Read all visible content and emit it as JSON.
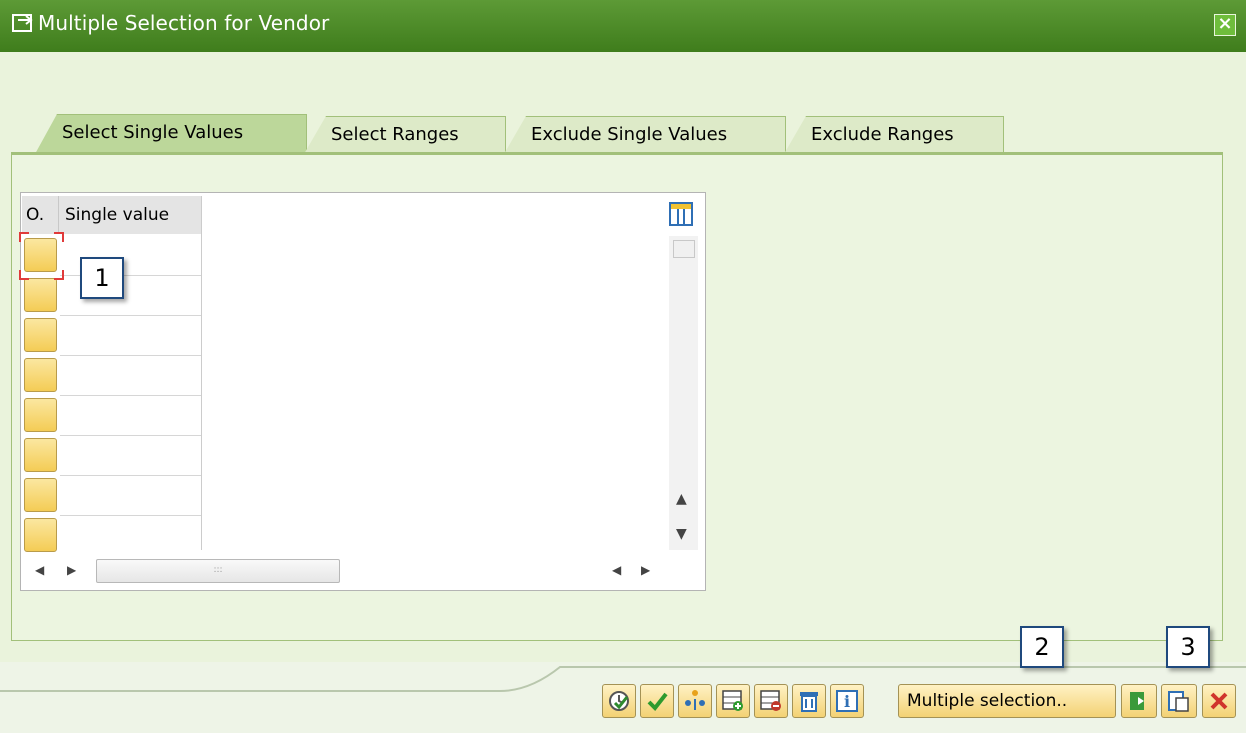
{
  "window": {
    "title": "Multiple Selection for Vendor",
    "close_icon": "close-icon"
  },
  "tabs": [
    {
      "label": "Select Single Values",
      "active": true
    },
    {
      "label": "Select Ranges",
      "active": false
    },
    {
      "label": "Exclude Single Values",
      "active": false
    },
    {
      "label": "Exclude Ranges",
      "active": false
    }
  ],
  "table": {
    "columns": [
      "O.",
      "Single value"
    ],
    "rows": [
      {
        "option": "",
        "value": ""
      },
      {
        "option": "",
        "value": ""
      },
      {
        "option": "",
        "value": ""
      },
      {
        "option": "",
        "value": ""
      },
      {
        "option": "",
        "value": ""
      },
      {
        "option": "",
        "value": ""
      },
      {
        "option": "",
        "value": ""
      },
      {
        "option": "",
        "value": ""
      }
    ]
  },
  "toolbar": {
    "buttons": [
      {
        "icon": "check-entries-icon"
      },
      {
        "icon": "copy-checkmark-icon"
      },
      {
        "icon": "import-from-list-icon"
      },
      {
        "icon": "insert-row-icon"
      },
      {
        "icon": "delete-row-icon"
      },
      {
        "icon": "delete-all-icon"
      },
      {
        "icon": "info-icon"
      },
      {
        "label": "Multiple selection.."
      },
      {
        "icon": "upload-from-clipboard-icon"
      },
      {
        "icon": "paste-from-clipboard-icon"
      },
      {
        "icon": "cancel-icon"
      }
    ]
  },
  "callouts": [
    "1",
    "2",
    "3"
  ],
  "colors": {
    "title_bar": "#4a8a25",
    "panel_bg": "#ecf5e0",
    "button_bg": "#f3d274",
    "cancel": "#d0342c"
  }
}
